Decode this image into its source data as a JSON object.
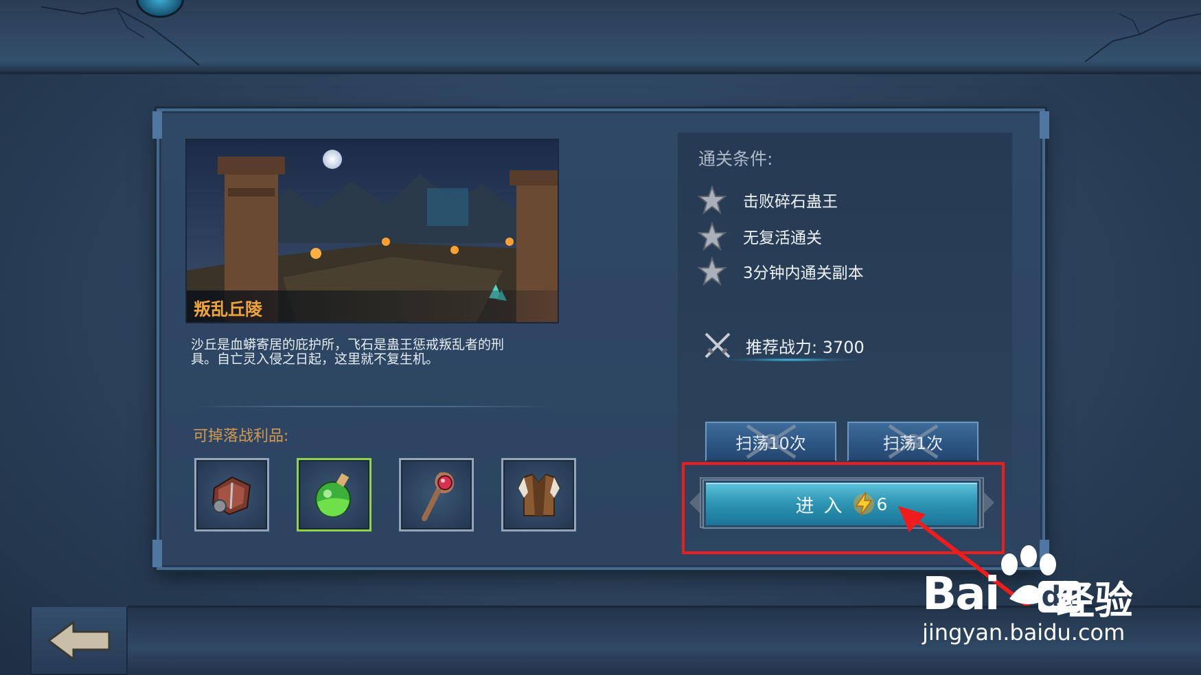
{
  "stage": {
    "name": "叛乱丘陵",
    "description_line1": "沙丘是血蟒寄居的庇护所，飞石是蛊王惩戒叛乱者的刑",
    "description_line2": "具。自亡灵入侵之日起，这里就不复生机。"
  },
  "loot": {
    "title": "可掉落战利品:",
    "items": [
      {
        "icon": "armor-bracer-icon",
        "border": "#93a5b9"
      },
      {
        "icon": "green-potion-icon",
        "border": "#8fd44a"
      },
      {
        "icon": "magic-staff-icon",
        "border": "#93a5b9"
      },
      {
        "icon": "leather-vest-icon",
        "border": "#93a5b9"
      }
    ]
  },
  "conditions": {
    "title": "通关条件:",
    "items": [
      {
        "label": "击败碎石蛊王"
      },
      {
        "label": "无复活通关"
      },
      {
        "label": "3分钟内通关副本"
      }
    ]
  },
  "power": {
    "label": "推荐战力: 3700"
  },
  "buttons": {
    "sweep10": "扫荡10次",
    "sweep1": "扫荡1次",
    "enter": "进入",
    "enter_cost": "6"
  },
  "watermark": {
    "brand": "Bai",
    "brand_du": "du",
    "suffix": "经验",
    "url": "jingyan.baidu.com"
  },
  "colors": {
    "stage_name": "#f0a43c",
    "loot_title": "#d49a52",
    "highlight": "#f01c1c",
    "enter_button": "#2f97b5"
  }
}
